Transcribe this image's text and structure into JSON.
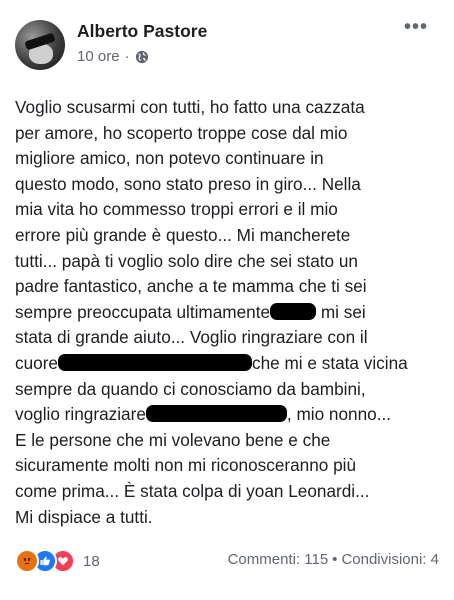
{
  "post": {
    "author": "Alberto Pastore",
    "time": "10 ore",
    "separator": "·",
    "privacy_icon": "globe-icon",
    "more_icon": "more-icon",
    "more_label": "•••",
    "lines": [
      "Voglio scusarmi con tutti, ho fatto una cazzata",
      "per amore, ho scoperto troppe cose dal mio",
      "migliore amico, non potevo continuare in",
      "questo modo, sono stato preso in giro... Nella",
      "mia vita ho commesso troppi errori e il mio",
      "errore più grande è questo...  Mi mancherete",
      "tutti... papà ti voglio solo dire che sei stato un",
      "padre fantastico, anche a te mamma che ti sei"
    ],
    "line9_before": "sempre preoccupata ultimamente",
    "line9_after": " mi sei",
    "line10": "stata di grande aiuto... Voglio ringraziare con il",
    "line11_before": "cuore",
    "line11_after": "che mi e stata vicina",
    "line12": "sempre da quando ci conosciamo da bambini,",
    "line13_before": "voglio ringraziare",
    "line13_after": ", mio nonno...",
    "lines_end": [
      "E le persone che mi volevano bene e che",
      "sicuramente molti non mi riconosceranno più",
      "come prima... È stata colpa di yoan Leonardi...",
      "Mi dispiace a tutti."
    ]
  },
  "footer": {
    "reactions": [
      "angry",
      "like",
      "love"
    ],
    "reaction_count": "18",
    "comments": "Commenti: 115",
    "dot": "•",
    "shares": "Condivisioni: 4"
  },
  "colors": {
    "text": "#1c1e21",
    "secondary": "#606770",
    "angry": "#e9710f",
    "like": "#2078f4",
    "love": "#f33e58"
  }
}
